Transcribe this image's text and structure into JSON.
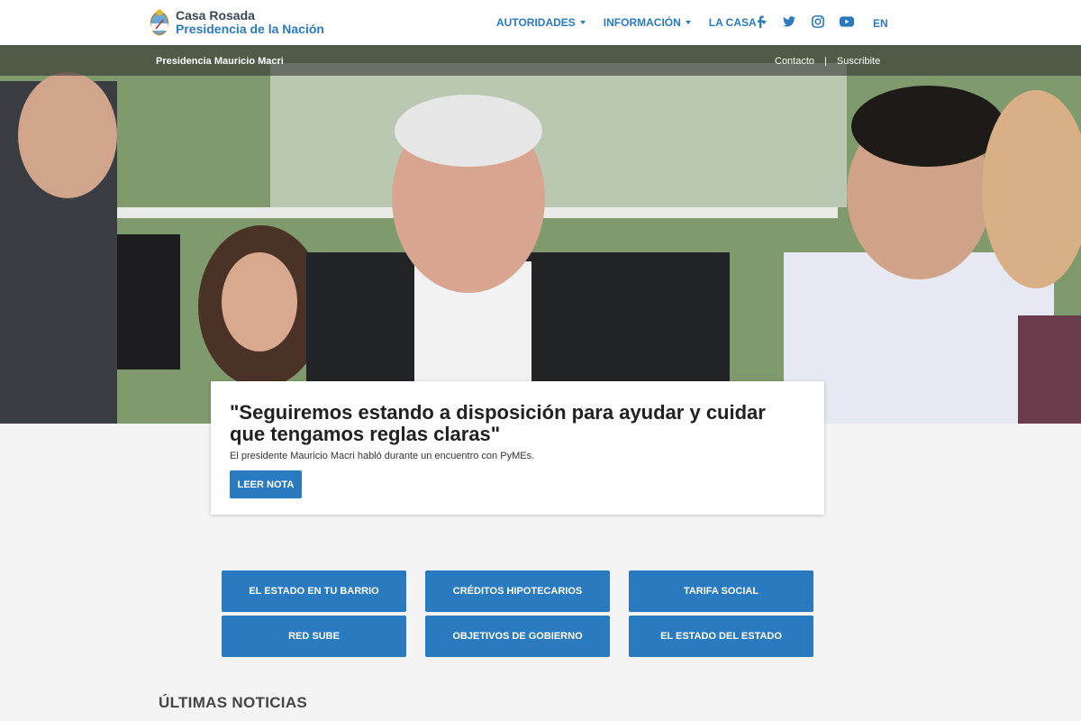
{
  "header": {
    "logo_top": "Casa Rosada",
    "logo_bottom": "Presidencia de la Nación",
    "nav": [
      "AUTORIDADES",
      "INFORMACIÓN",
      "LA CASA"
    ],
    "social_icons": [
      "facebook-icon",
      "twitter-icon",
      "instagram-icon",
      "youtube-icon"
    ],
    "lang": "EN"
  },
  "hero": {
    "bar_left": "Presidencia Mauricio Macri",
    "links": [
      "Contacto",
      "|",
      "Suscribite"
    ]
  },
  "featured": {
    "title": "\"Seguiremos estando a disposición para ayudar y cuidar que tengamos reglas claras\"",
    "subtitle": "El presidente Mauricio Macri habló durante un encuentro con PyMEs.",
    "button": "LEER NOTA"
  },
  "quick_links": [
    "EL ESTADO EN TU BARRIO",
    "CRÉDITOS HIPOTECARIOS",
    "TARIFA SOCIAL",
    "RED SUBE",
    "OBJETIVOS DE GOBIERNO",
    "EL ESTADO DEL ESTADO"
  ],
  "news_heading": "ÚLTIMAS NOTICIAS",
  "colors": {
    "accent": "#2a7ac0",
    "background": "#f4f4f4",
    "text_dark": "#212121"
  }
}
